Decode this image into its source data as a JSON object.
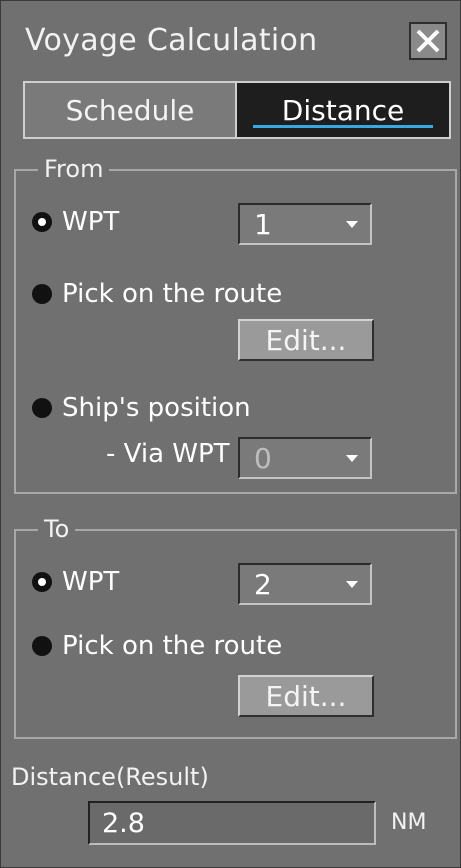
{
  "window": {
    "title": "Voyage Calculation",
    "close_icon": "close-icon"
  },
  "tabs": [
    {
      "label": "Schedule",
      "active": false
    },
    {
      "label": "Distance",
      "active": true
    }
  ],
  "colors": {
    "background": "#707070",
    "active_tab": "#1e1e1e",
    "tab_underline": "#38a8e0"
  },
  "from": {
    "legend": "From",
    "wpt_label": "WPT",
    "wpt_selected": true,
    "wpt_value": "1",
    "pick_label": "Pick on the route",
    "pick_edit_label": "Edit...",
    "ship_label": "Ship's position",
    "via_label": "- Via WPT",
    "via_value": "0"
  },
  "to": {
    "legend": "To",
    "wpt_label": "WPT",
    "wpt_selected": true,
    "wpt_value": "2",
    "pick_label": "Pick on the route",
    "pick_edit_label": "Edit..."
  },
  "result": {
    "label": "Distance(Result)",
    "value": "2.8",
    "unit": "NM"
  }
}
